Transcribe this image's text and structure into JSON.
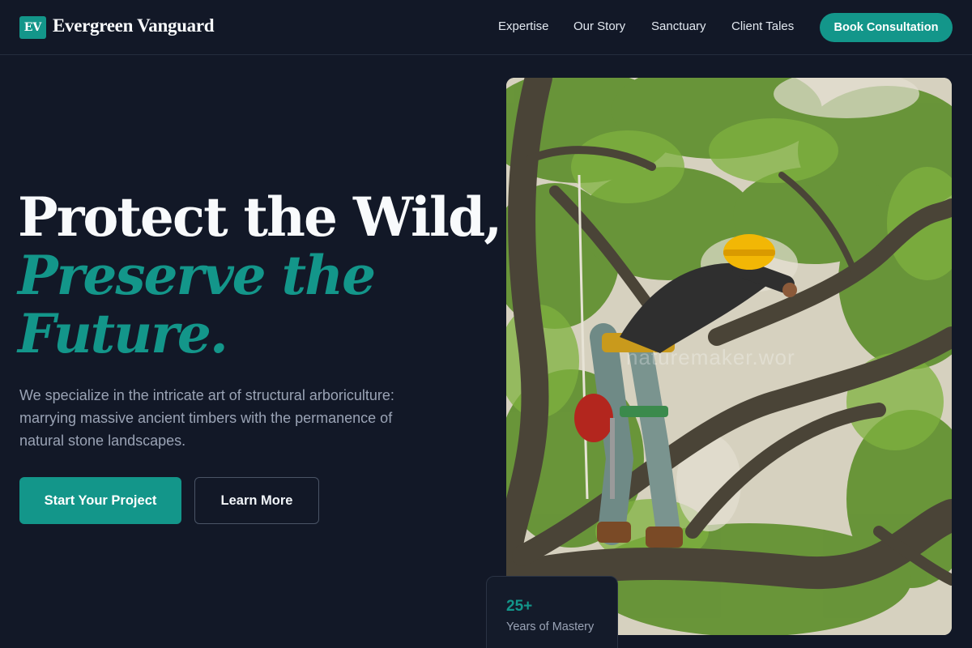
{
  "header": {
    "logo_mark": "EV",
    "brand": "Evergreen Vanguard",
    "nav": [
      {
        "label": "Expertise"
      },
      {
        "label": "Our Story"
      },
      {
        "label": "Sanctuary"
      },
      {
        "label": "Client Tales"
      }
    ],
    "cta_label": "Book Consultation"
  },
  "hero": {
    "headline_line1": "Protect the Wild,",
    "headline_accent_line1": "Preserve the",
    "headline_accent_line2": "Future.",
    "subtext": "We specialize in the intricate art of structural arboriculture: marrying massive ancient timbers with the permanence of natural stone landscapes.",
    "primary_button": "Start Your Project",
    "secondary_button": "Learn More",
    "image_watermark": "naturemaker.wor"
  },
  "stat": {
    "value": "25+",
    "label": "Years of Mastery"
  },
  "colors": {
    "background": "#121827",
    "accent": "#13968a",
    "muted_text": "#9aa3b5"
  }
}
